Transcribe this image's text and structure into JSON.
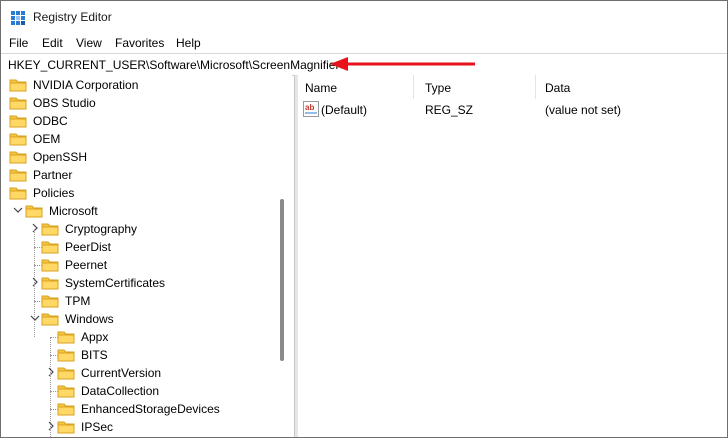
{
  "window": {
    "title": "Registry Editor"
  },
  "menu": [
    "File",
    "Edit",
    "View",
    "Favorites",
    "Help"
  ],
  "address": {
    "path": "HKEY_CURRENT_USER\\Software\\Microsoft\\ScreenMagnifier"
  },
  "tree": [
    {
      "label": "NVIDIA Corporation",
      "depth": 0,
      "expander": "none"
    },
    {
      "label": "OBS Studio",
      "depth": 0,
      "expander": "none"
    },
    {
      "label": "ODBC",
      "depth": 0,
      "expander": "none"
    },
    {
      "label": "OEM",
      "depth": 0,
      "expander": "none"
    },
    {
      "label": "OpenSSH",
      "depth": 0,
      "expander": "none"
    },
    {
      "label": "Partner",
      "depth": 0,
      "expander": "none"
    },
    {
      "label": "Policies",
      "depth": 0,
      "expander": "none"
    },
    {
      "label": "Microsoft",
      "depth": 1,
      "expander": "expanded"
    },
    {
      "label": "Cryptography",
      "depth": 2,
      "expander": "collapsed"
    },
    {
      "label": "PeerDist",
      "depth": 2,
      "expander": "none"
    },
    {
      "label": "Peernet",
      "depth": 2,
      "expander": "none"
    },
    {
      "label": "SystemCertificates",
      "depth": 2,
      "expander": "collapsed"
    },
    {
      "label": "TPM",
      "depth": 2,
      "expander": "none"
    },
    {
      "label": "Windows",
      "depth": 2,
      "expander": "expanded"
    },
    {
      "label": "Appx",
      "depth": 3,
      "expander": "none"
    },
    {
      "label": "BITS",
      "depth": 3,
      "expander": "none"
    },
    {
      "label": "CurrentVersion",
      "depth": 3,
      "expander": "collapsed"
    },
    {
      "label": "DataCollection",
      "depth": 3,
      "expander": "none"
    },
    {
      "label": "EnhancedStorageDevices",
      "depth": 3,
      "expander": "none"
    },
    {
      "label": "IPSec",
      "depth": 3,
      "expander": "collapsed"
    }
  ],
  "list": {
    "columns": [
      "Name",
      "Type",
      "Data"
    ],
    "rows": [
      {
        "name": "(Default)",
        "type": "REG_SZ",
        "data": "(value not set)",
        "icon": "string-value-icon"
      }
    ]
  },
  "colors": {
    "annotation_arrow": "#e8121b",
    "folder": "#f5c542",
    "folder_dark": "#e0a82e"
  },
  "icons": {
    "app": "registry-editor-icon",
    "folder": "folder-icon",
    "expand": "chevron-right-icon",
    "collapse": "chevron-down-icon"
  }
}
